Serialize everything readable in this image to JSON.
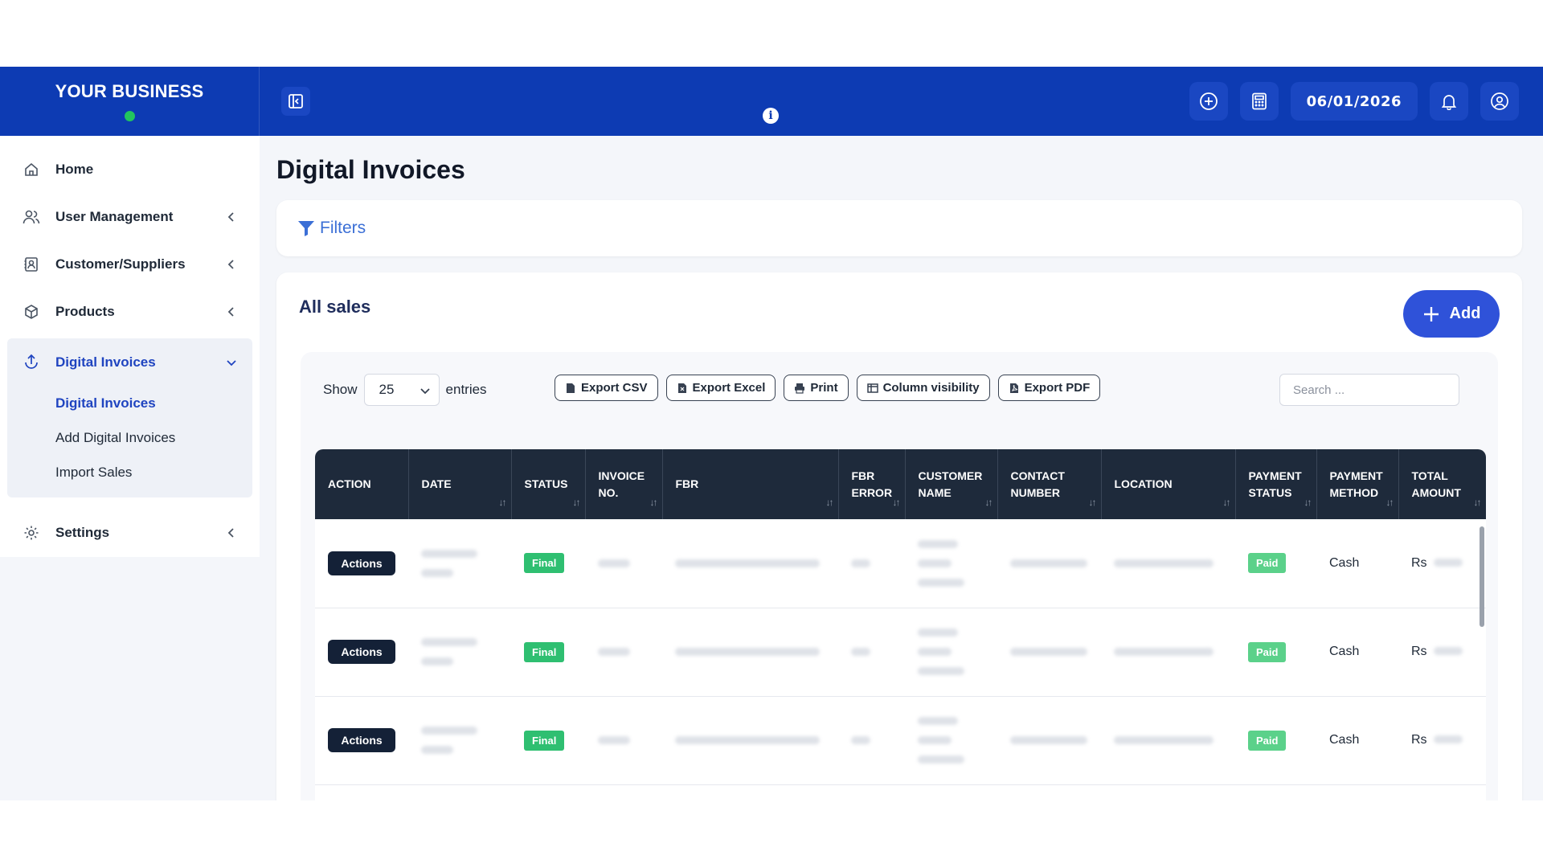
{
  "app": {
    "brand": "YOUR BUSINESS",
    "status_color": "#22c55e",
    "date": "06/01/2026"
  },
  "topbar": {
    "icons": [
      "sidebar-toggle-icon",
      "info-icon",
      "plus-circle-icon",
      "calculator-icon",
      "bell-icon",
      "user-circle-icon"
    ]
  },
  "sidebar": {
    "items": [
      {
        "label": "Home",
        "icon": "home-icon"
      },
      {
        "label": "User Management",
        "icon": "users-icon"
      },
      {
        "label": "Customer/Suppliers",
        "icon": "contact-card-icon"
      },
      {
        "label": "Products",
        "icon": "box-icon"
      },
      {
        "label": "Digital Invoices",
        "icon": "upload-icon"
      },
      {
        "label": "Settings",
        "icon": "gear-icon"
      }
    ],
    "sub_items": [
      "Digital Invoices",
      "Add Digital Invoices",
      "Import Sales"
    ]
  },
  "main": {
    "title": "Digital Invoices",
    "filters_label": "Filters",
    "sales_title": "All sales",
    "add_label": "Add",
    "show_label": "Show",
    "entries_value": "25",
    "entries_label": "entries",
    "export_buttons": [
      "Export CSV",
      "Export Excel",
      "Print",
      "Column visibility",
      "Export PDF"
    ],
    "search_placeholder": "Search ..."
  },
  "table": {
    "columns": [
      {
        "line1": "ACTION",
        "line2": ""
      },
      {
        "line1": "DATE",
        "line2": ""
      },
      {
        "line1": "STATUS",
        "line2": ""
      },
      {
        "line1": "INVOICE",
        "line2": "NO."
      },
      {
        "line1": "FBR",
        "line2": ""
      },
      {
        "line1": "FBR",
        "line2": "ERROR"
      },
      {
        "line1": "CUSTOMER",
        "line2": "NAME"
      },
      {
        "line1": "CONTACT",
        "line2": "NUMBER"
      },
      {
        "line1": "LOCATION",
        "line2": ""
      },
      {
        "line1": "PAYMENT",
        "line2": "STATUS"
      },
      {
        "line1": "PAYMENT",
        "line2": "METHOD"
      },
      {
        "line1": "TOTAL",
        "line2": "AMOUNT"
      }
    ],
    "rows": [
      {
        "action": "Actions",
        "status": "Final",
        "payment_status": "Paid",
        "payment_method": "Cash",
        "currency": "Rs"
      },
      {
        "action": "Actions",
        "status": "Final",
        "payment_status": "Paid",
        "payment_method": "Cash",
        "currency": "Rs"
      },
      {
        "action": "Actions",
        "status": "Final",
        "payment_status": "Paid",
        "payment_method": "Cash",
        "currency": "Rs"
      }
    ]
  }
}
